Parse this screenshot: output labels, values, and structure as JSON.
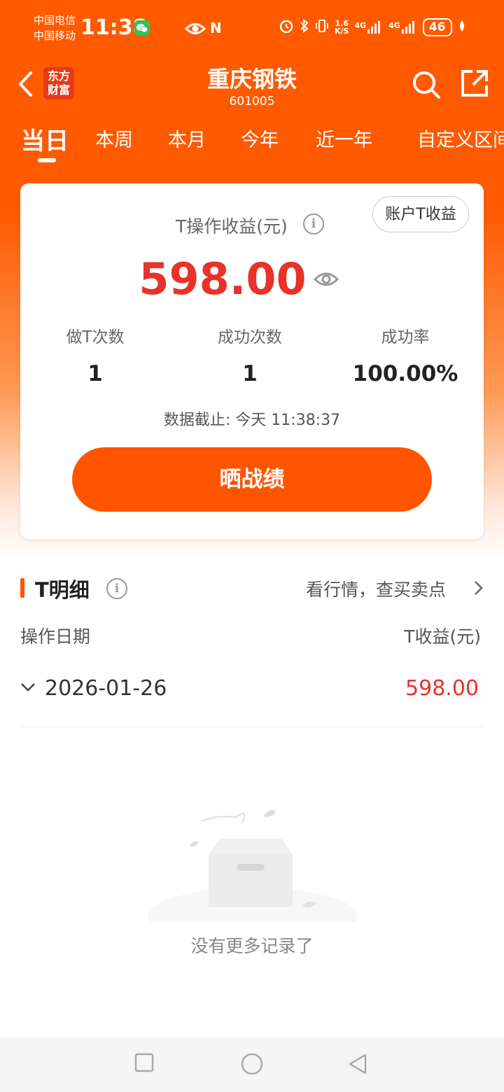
{
  "status_bar": {
    "carrier1": "中国电信",
    "carrier2": "中国移动",
    "time": "11:38",
    "net_speed": "1.6",
    "net_unit": "K/S",
    "sig1": "4G",
    "sig2": "4G",
    "battery": "46",
    "nfc": "N"
  },
  "header": {
    "logo_line1": "东方",
    "logo_line2": "财富",
    "title": "重庆钢铁",
    "code": "601005"
  },
  "tabs": [
    "当日",
    "本周",
    "本月",
    "今年",
    "近一年",
    "自定义区间"
  ],
  "summary": {
    "label": "T操作收益(元)",
    "account_button": "账户T收益",
    "profit": "598.00",
    "stats": [
      {
        "label": "做T次数",
        "value": "1"
      },
      {
        "label": "成功次数",
        "value": "1"
      },
      {
        "label": "成功率",
        "value": "100.00%"
      }
    ],
    "as_of": "数据截止: 今天 11:38:37",
    "share_button": "晒战绩"
  },
  "details": {
    "title": "T明细",
    "link": "看行情，查买卖点",
    "col_date": "操作日期",
    "col_profit": "T收益(元)",
    "rows": [
      {
        "date": "2026-01-26",
        "profit": "598.00"
      }
    ],
    "empty_text": "没有更多记录了"
  },
  "colors": {
    "brand": "#ff5a00",
    "profit_red": "#e8322a"
  }
}
